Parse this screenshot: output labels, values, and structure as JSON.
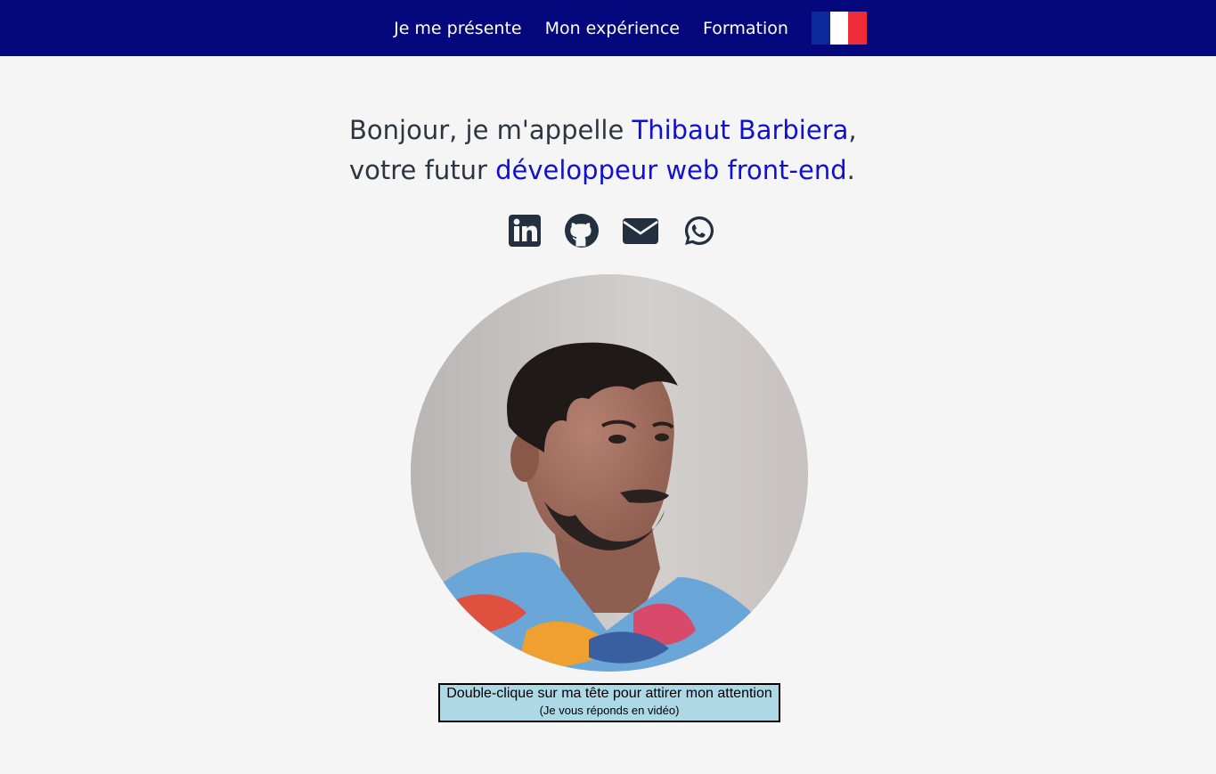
{
  "nav": {
    "links": [
      {
        "label": "Je me présente"
      },
      {
        "label": "Mon expérience"
      },
      {
        "label": "Formation"
      }
    ],
    "flag_colors": [
      "#0a2a9c",
      "#ffffff",
      "#ef2b3a"
    ]
  },
  "hero": {
    "line1_prefix": "Bonjour, je m'appelle ",
    "name": "Thibaut Barbiera",
    "line1_suffix": ",",
    "line2_prefix": "votre futur ",
    "role": "développeur web front-end",
    "line2_suffix": "."
  },
  "socials": [
    {
      "icon": "linkedin-icon"
    },
    {
      "icon": "github-icon"
    },
    {
      "icon": "mail-icon"
    },
    {
      "icon": "whatsapp-icon"
    }
  ],
  "caption": {
    "main": "Double-clique sur ma tête pour attirer mon attention",
    "sub": "(Je vous réponds en vidéo)"
  },
  "colors": {
    "nav_bg": "#05087c",
    "accent": "#1010d0",
    "text": "#2b3642",
    "page_bg": "#f5f5f5",
    "caption_bg": "#add8e6"
  }
}
